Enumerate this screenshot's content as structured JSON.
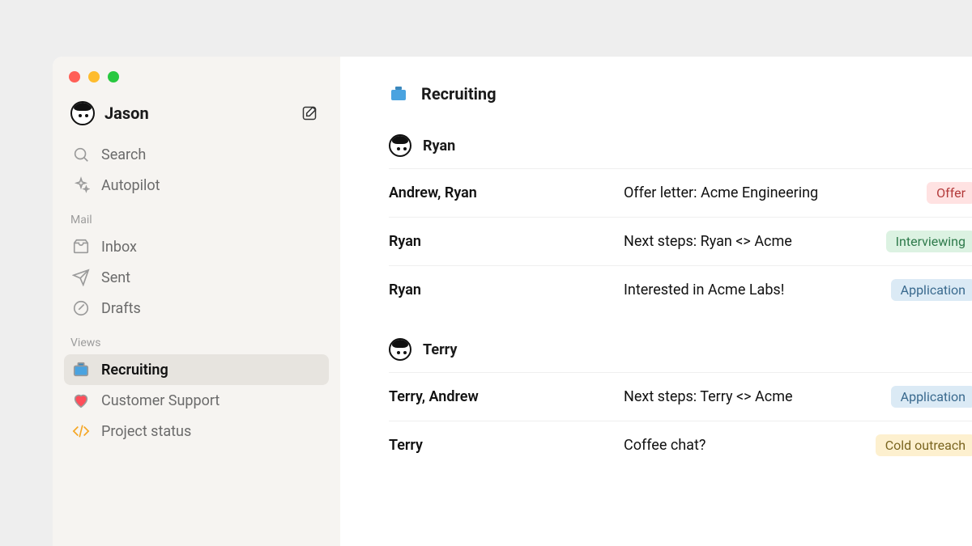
{
  "user": {
    "name": "Jason"
  },
  "sidebar": {
    "search_label": "Search",
    "autopilot_label": "Autopilot",
    "sections": {
      "mail_label": "Mail",
      "views_label": "Views"
    },
    "mail": {
      "inbox": "Inbox",
      "sent": "Sent",
      "drafts": "Drafts"
    },
    "views": {
      "recruiting": "Recruiting",
      "customer_support": "Customer Support",
      "project_status": "Project status"
    }
  },
  "main": {
    "title": "Recruiting",
    "groups": [
      {
        "name": "Ryan",
        "threads": [
          {
            "who": "Andrew, Ryan",
            "subject": "Offer letter: Acme Engineering",
            "tag": "Offer",
            "tag_class": "tag-red"
          },
          {
            "who": "Ryan",
            "subject": "Next steps: Ryan <> Acme",
            "tag": "Interviewing",
            "tag_class": "tag-green"
          },
          {
            "who": "Ryan",
            "subject": "Interested in Acme Labs!",
            "tag": "Application",
            "tag_class": "tag-blue"
          }
        ]
      },
      {
        "name": "Terry",
        "threads": [
          {
            "who": "Terry, Andrew",
            "subject": "Next steps: Terry <> Acme",
            "tag": "Application",
            "tag_class": "tag-blue"
          },
          {
            "who": "Terry",
            "subject": "Coffee chat?",
            "tag": "Cold outreach",
            "tag_class": "tag-amber"
          }
        ]
      }
    ]
  }
}
